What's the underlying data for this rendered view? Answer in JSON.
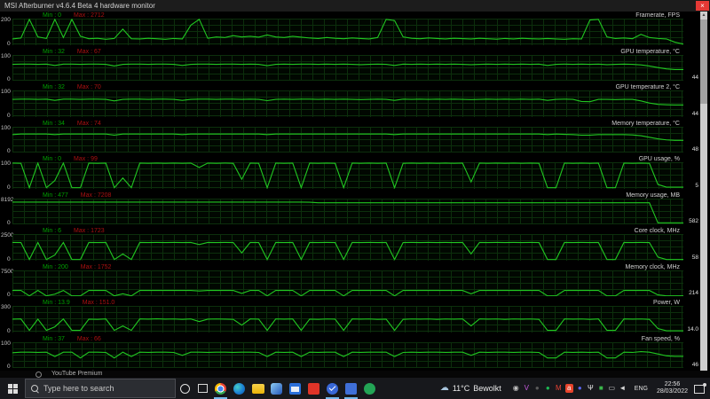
{
  "window": {
    "title": "MSI Afterburner v4.6.4 Beta 4 hardware monitor",
    "close_glyph": "×"
  },
  "colors": {
    "line": "#21c621",
    "grid": "#0c2f0c",
    "min_text": "#00a000",
    "max_text": "#aa1111",
    "taskbar": "#17181c",
    "active_underline": "#76b9ed",
    "close_button": "#e53935"
  },
  "panels": [
    {
      "name": "Framerate, FPS",
      "min_label": "Min : 0",
      "max_label": "Max : 2712",
      "axis_top": "200",
      "axis_bottom": "0",
      "current": "",
      "ylim": [
        0,
        200
      ],
      "series": [
        45,
        52,
        200,
        60,
        48,
        195,
        55,
        200,
        65,
        46,
        50,
        42,
        48,
        120,
        46,
        44,
        50,
        46,
        42,
        48,
        45,
        150,
        200,
        50,
        60,
        55,
        70,
        60,
        65,
        58,
        75,
        60,
        55,
        65,
        58,
        52,
        48,
        55,
        50,
        46,
        52,
        48,
        45,
        55,
        200,
        185,
        60,
        50,
        46,
        52,
        48,
        45,
        50,
        47,
        44,
        50,
        46,
        43,
        48,
        45,
        50,
        46,
        44,
        48,
        45,
        42,
        46,
        44,
        190,
        200,
        60,
        48,
        52,
        46,
        80,
        55,
        48,
        45,
        20,
        0
      ]
    },
    {
      "name": "GPU temperature, °C",
      "min_label": "Min : 32",
      "max_label": "Max : 67",
      "axis_top": "100",
      "axis_bottom": "0",
      "current": "44",
      "ylim": [
        0,
        100
      ],
      "series": [
        64,
        65,
        65,
        64,
        65,
        60,
        65,
        65,
        64,
        65,
        65,
        64,
        58,
        64,
        65,
        65,
        64,
        65,
        65,
        64,
        60,
        64,
        65,
        65,
        64,
        65,
        65,
        64,
        65,
        64,
        59,
        64,
        65,
        64,
        65,
        65,
        64,
        65,
        64,
        65,
        64,
        63,
        64,
        65,
        64,
        60,
        65,
        64,
        65,
        64,
        65,
        64,
        65,
        64,
        63,
        64,
        65,
        64,
        65,
        64,
        65,
        64,
        65,
        60,
        64,
        65,
        64,
        65,
        64,
        65,
        63,
        64,
        65,
        64,
        62,
        58,
        52,
        47,
        44,
        44
      ]
    },
    {
      "name": "GPU temperature 2, °C",
      "min_label": "Min : 32",
      "max_label": "Max : 70",
      "axis_top": "100",
      "axis_bottom": "0",
      "current": "44",
      "ylim": [
        0,
        100
      ],
      "series": [
        66,
        67,
        67,
        66,
        67,
        62,
        67,
        67,
        66,
        67,
        67,
        66,
        60,
        66,
        67,
        67,
        66,
        67,
        67,
        66,
        62,
        66,
        67,
        67,
        66,
        67,
        67,
        66,
        67,
        66,
        61,
        66,
        67,
        66,
        67,
        67,
        66,
        67,
        66,
        67,
        66,
        65,
        66,
        67,
        66,
        62,
        67,
        66,
        67,
        66,
        67,
        66,
        67,
        66,
        65,
        66,
        67,
        66,
        67,
        66,
        67,
        66,
        67,
        62,
        66,
        67,
        66,
        58,
        57,
        66,
        66,
        65,
        66,
        66,
        60,
        52,
        47,
        45,
        44,
        44
      ]
    },
    {
      "name": "Memory temperature, °C",
      "min_label": "Min : 34",
      "max_label": "Max : 74",
      "axis_top": "100",
      "axis_bottom": "0",
      "current": "48",
      "ylim": [
        0,
        100
      ],
      "series": [
        70,
        72,
        72,
        72,
        72,
        70,
        72,
        72,
        72,
        72,
        72,
        72,
        68,
        72,
        72,
        72,
        72,
        72,
        72,
        72,
        70,
        72,
        72,
        72,
        72,
        72,
        72,
        72,
        72,
        72,
        70,
        72,
        72,
        72,
        72,
        72,
        72,
        72,
        72,
        72,
        72,
        72,
        72,
        72,
        72,
        70,
        72,
        72,
        72,
        72,
        72,
        72,
        72,
        72,
        72,
        72,
        72,
        72,
        72,
        72,
        72,
        72,
        72,
        70,
        72,
        71,
        70,
        68,
        68,
        70,
        70,
        70,
        70,
        69,
        66,
        60,
        54,
        50,
        48,
        48
      ]
    },
    {
      "name": "GPU usage, %",
      "min_label": "Min : 0",
      "max_label": "Max : 99",
      "axis_top": "100",
      "axis_bottom": "0",
      "current": "5",
      "ylim": [
        0,
        100
      ],
      "series": [
        97,
        96,
        2,
        97,
        2,
        30,
        97,
        2,
        2,
        97,
        96,
        97,
        2,
        40,
        2,
        97,
        96,
        97,
        96,
        97,
        96,
        97,
        80,
        97,
        96,
        97,
        96,
        35,
        97,
        96,
        2,
        97,
        96,
        97,
        2,
        97,
        96,
        97,
        96,
        2,
        97,
        96,
        97,
        96,
        97,
        2,
        96,
        97,
        96,
        97,
        96,
        97,
        96,
        97,
        25,
        97,
        96,
        97,
        96,
        97,
        96,
        97,
        96,
        2,
        2,
        97,
        96,
        97,
        96,
        97,
        2,
        2,
        97,
        96,
        97,
        96,
        15,
        5,
        5,
        5
      ]
    },
    {
      "name": "Memory usage, MB",
      "min_label": "Min : 477",
      "max_label": "Max : 7208",
      "axis_top": "8192",
      "axis_bottom": "0",
      "current": "582",
      "ylim": [
        0,
        8192
      ],
      "series": [
        7100,
        7100,
        7100,
        7100,
        7100,
        7100,
        7100,
        7100,
        7100,
        7100,
        7100,
        7100,
        7100,
        7100,
        7100,
        7100,
        7100,
        7100,
        7100,
        7100,
        7100,
        7100,
        7100,
        7100,
        7100,
        7100,
        7100,
        7100,
        7100,
        7100,
        7100,
        7100,
        7100,
        7100,
        7100,
        7050,
        6900,
        6900,
        6900,
        6900,
        6900,
        6900,
        6900,
        6900,
        6900,
        6900,
        6900,
        6900,
        6900,
        6900,
        6900,
        6900,
        6900,
        6900,
        6900,
        6900,
        6900,
        6900,
        6900,
        6900,
        6900,
        6900,
        6900,
        6900,
        6900,
        6900,
        6900,
        6900,
        6900,
        6900,
        6900,
        6900,
        6900,
        6900,
        6900,
        6900,
        582,
        582,
        582,
        582
      ]
    },
    {
      "name": "Core clock, MHz",
      "min_label": "Min : 6",
      "max_label": "Max : 1723",
      "axis_top": "2500",
      "axis_bottom": "0",
      "current": "58",
      "ylim": [
        0,
        2500
      ],
      "series": [
        1700,
        1690,
        60,
        1700,
        60,
        500,
        1700,
        60,
        60,
        1700,
        1690,
        1700,
        60,
        600,
        60,
        1700,
        1690,
        1700,
        1690,
        1700,
        1690,
        1700,
        1500,
        1700,
        1690,
        1700,
        1690,
        700,
        1700,
        1690,
        60,
        1700,
        1690,
        1700,
        60,
        1700,
        1690,
        1700,
        1690,
        60,
        1700,
        1690,
        1700,
        1690,
        1700,
        60,
        1690,
        1700,
        1690,
        1700,
        1690,
        1700,
        1690,
        1700,
        600,
        1700,
        1690,
        1700,
        1690,
        1700,
        1690,
        1700,
        1690,
        60,
        60,
        1700,
        1690,
        1700,
        1690,
        1700,
        60,
        60,
        1700,
        1690,
        1700,
        1690,
        300,
        58,
        58,
        58
      ]
    },
    {
      "name": "Memory clock, MHz",
      "min_label": "Min : 200",
      "max_label": "Max : 1752",
      "axis_top": "7500",
      "axis_bottom": "0",
      "current": "214",
      "ylim": [
        0,
        7500
      ],
      "series": [
        1750,
        1750,
        200,
        1750,
        200,
        700,
        1750,
        200,
        200,
        1750,
        1750,
        1750,
        200,
        800,
        200,
        1750,
        1750,
        1750,
        1750,
        1750,
        1750,
        1750,
        1600,
        1750,
        1750,
        1750,
        1750,
        900,
        1750,
        1750,
        200,
        1750,
        1750,
        1750,
        200,
        1750,
        1750,
        1750,
        1750,
        200,
        1750,
        1750,
        1750,
        1750,
        1750,
        200,
        1750,
        1750,
        1750,
        1750,
        1750,
        1750,
        1750,
        1750,
        800,
        1750,
        1750,
        1750,
        1750,
        1750,
        1750,
        1750,
        1750,
        200,
        200,
        1750,
        1750,
        1750,
        1750,
        1750,
        200,
        200,
        1750,
        1750,
        1750,
        1750,
        500,
        214,
        214,
        214
      ]
    },
    {
      "name": "Power, W",
      "min_label": "Min : 13.9",
      "max_label": "Max : 151.0",
      "axis_top": "300",
      "axis_bottom": "0",
      "current": "14.0",
      "ylim": [
        0,
        300
      ],
      "series": [
        148,
        150,
        20,
        148,
        20,
        60,
        150,
        20,
        20,
        148,
        146,
        150,
        20,
        70,
        20,
        150,
        148,
        152,
        148,
        150,
        146,
        150,
        120,
        148,
        150,
        148,
        146,
        80,
        150,
        148,
        20,
        150,
        148,
        150,
        20,
        148,
        146,
        150,
        148,
        20,
        150,
        148,
        150,
        146,
        148,
        20,
        146,
        150,
        148,
        150,
        146,
        150,
        148,
        150,
        70,
        150,
        148,
        150,
        146,
        150,
        148,
        150,
        146,
        20,
        20,
        150,
        148,
        150,
        146,
        150,
        20,
        20,
        150,
        148,
        150,
        146,
        40,
        14,
        14,
        14
      ]
    },
    {
      "name": "Fan speed, %",
      "min_label": "Min : 37",
      "max_label": "Max : 66",
      "axis_top": "100",
      "axis_bottom": "0",
      "current": "46",
      "ylim": [
        0,
        100
      ],
      "series": [
        60,
        62,
        62,
        61,
        62,
        45,
        62,
        62,
        40,
        62,
        62,
        61,
        40,
        62,
        45,
        62,
        61,
        62,
        62,
        61,
        50,
        62,
        62,
        61,
        62,
        62,
        61,
        62,
        62,
        61,
        45,
        62,
        61,
        62,
        45,
        62,
        61,
        62,
        62,
        45,
        62,
        61,
        62,
        62,
        62,
        45,
        61,
        62,
        61,
        62,
        62,
        61,
        62,
        62,
        50,
        62,
        61,
        62,
        62,
        61,
        62,
        62,
        61,
        40,
        40,
        62,
        61,
        62,
        61,
        62,
        40,
        40,
        62,
        61,
        64,
        62,
        55,
        48,
        46,
        46
      ]
    }
  ],
  "background_window": {
    "title": "YouTube Premium"
  },
  "taskbar": {
    "search_placeholder": "Type here to search",
    "apps": [
      {
        "name": "chrome",
        "active": true
      },
      {
        "name": "edge",
        "active": false
      },
      {
        "name": "explorer",
        "active": false
      },
      {
        "name": "photos",
        "active": false
      },
      {
        "name": "mail",
        "active": false
      },
      {
        "name": "app-red",
        "active": false
      },
      {
        "name": "todo",
        "active": true
      },
      {
        "name": "app-blue",
        "active": true
      },
      {
        "name": "app-green",
        "active": false
      }
    ],
    "weather": {
      "icon_glyph": "☁",
      "temp": "11°C",
      "condition": "Bewolkt"
    },
    "tray": [
      {
        "name": "steam-icon",
        "glyph": "◉",
        "color": "#c0c0c0",
        "bg": ""
      },
      {
        "name": "v-app-icon",
        "glyph": "V",
        "color": "#c85ae0",
        "bg": ""
      },
      {
        "name": "dark-app-icon",
        "glyph": "●",
        "color": "#5a5a5a",
        "bg": ""
      },
      {
        "name": "spotify-icon",
        "glyph": "●",
        "color": "#1db954",
        "bg": ""
      },
      {
        "name": "gmail-icon",
        "glyph": "M",
        "color": "#ea4335",
        "bg": ""
      },
      {
        "name": "adobe-icon",
        "glyph": "a",
        "color": "#ffffff",
        "bg": "#e8442c"
      },
      {
        "name": "discord-icon",
        "glyph": "●",
        "color": "#5865f2",
        "bg": ""
      },
      {
        "name": "microphone-icon",
        "glyph": "Ψ",
        "color": "#e6e6e6",
        "bg": ""
      },
      {
        "name": "nvidia-icon",
        "glyph": "■",
        "color": "#3ab54a",
        "bg": ""
      },
      {
        "name": "display-icon",
        "glyph": "▭",
        "color": "#d8d8d8",
        "bg": ""
      },
      {
        "name": "volume-icon",
        "glyph": "◄",
        "color": "#d8d8d8",
        "bg": ""
      }
    ],
    "language": "ENG",
    "clock": {
      "time": "22:56",
      "date": "28/03/2022"
    }
  },
  "scrollbar": {
    "up_glyph": "▲",
    "down_glyph": "▼"
  }
}
